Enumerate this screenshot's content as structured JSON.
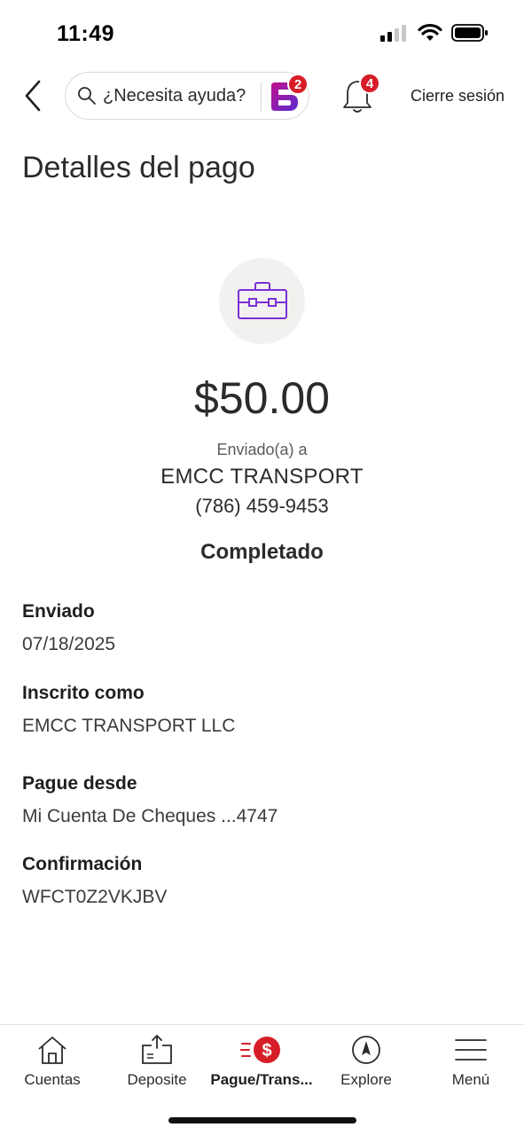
{
  "status_bar": {
    "time": "11:49"
  },
  "header": {
    "search_placeholder": "¿Necesita ayuda?",
    "assistant_badge": "2",
    "notifications_badge": "4",
    "signout_label": "Cierre sesión"
  },
  "page": {
    "title": "Detalles del pago"
  },
  "payment": {
    "amount": "$50.00",
    "sent_to_label": "Enviado(a) a",
    "payee_name": "EMCC TRANSPORT",
    "payee_phone": "(786) 459-9453",
    "status": "Completado"
  },
  "details": [
    {
      "label": "Enviado",
      "value": "07/18/2025"
    },
    {
      "label": "Inscrito como",
      "value": "EMCC TRANSPORT LLC"
    },
    {
      "label": "Pague desde",
      "value": "Mi Cuenta De Cheques ...4747"
    },
    {
      "label": "Confirmación",
      "value": "WFCT0Z2VKJBV"
    }
  ],
  "tab_bar": {
    "tabs": [
      {
        "label": "Cuentas",
        "icon": "home-icon"
      },
      {
        "label": "Deposite",
        "icon": "deposit-icon"
      },
      {
        "label": "Pague/Trans...",
        "icon": "pay-transfer-icon",
        "active": true
      },
      {
        "label": "Explore",
        "icon": "compass-icon"
      },
      {
        "label": "Menú",
        "icon": "hamburger-menu-icon"
      }
    ]
  },
  "colors": {
    "accent_red": "#d71e28",
    "purple_icon": "#7b2fd6",
    "avatar_bg": "#f3f1ef"
  }
}
